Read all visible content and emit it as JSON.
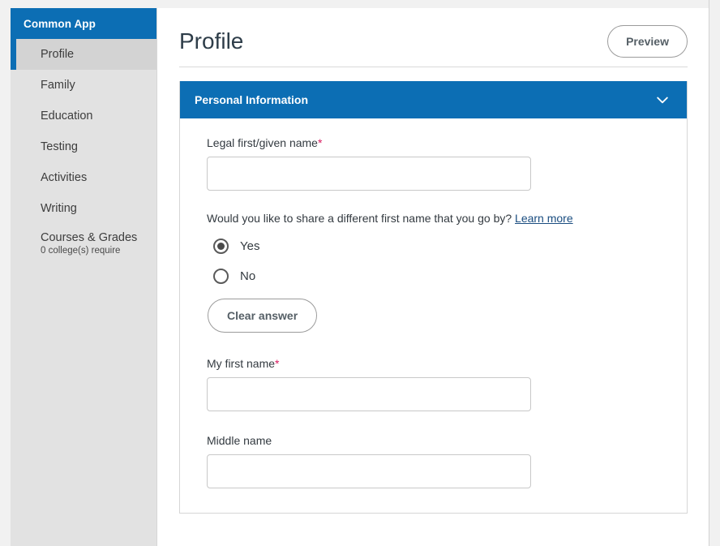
{
  "sidebar": {
    "brand": "Common App",
    "items": [
      {
        "label": "Profile",
        "active": true
      },
      {
        "label": "Family",
        "active": false
      },
      {
        "label": "Education",
        "active": false
      },
      {
        "label": "Testing",
        "active": false
      },
      {
        "label": "Activities",
        "active": false
      },
      {
        "label": "Writing",
        "active": false
      },
      {
        "label": "Courses & Grades",
        "sublabel": "0 college(s) require",
        "active": false
      }
    ]
  },
  "header": {
    "title": "Profile",
    "preview_label": "Preview"
  },
  "section": {
    "title": "Personal Information",
    "collapse_icon": "chevron-down-icon",
    "expanded": true
  },
  "form": {
    "legal_first_name": {
      "label": "Legal first/given name",
      "required_marker": "*",
      "value": "",
      "placeholder": ""
    },
    "different_name_question": {
      "text": "Would you like to share a different first name that you go by?",
      "link_label": "Learn more",
      "options": [
        {
          "label": "Yes",
          "selected": true
        },
        {
          "label": "No",
          "selected": false
        }
      ],
      "clear_label": "Clear answer"
    },
    "my_first_name": {
      "label": "My first name",
      "required_marker": "*",
      "value": "",
      "placeholder": ""
    },
    "middle_name": {
      "label": "Middle name",
      "required_marker": "",
      "value": "",
      "placeholder": ""
    }
  },
  "colors": {
    "brand_blue": "#0c6eb4",
    "sidebar_bg": "#e2e2e2",
    "sidebar_active_bg": "#d3d3d3",
    "required_star": "#d81b60",
    "link": "#1a4d80",
    "page_bg": "#f1f1f1"
  }
}
